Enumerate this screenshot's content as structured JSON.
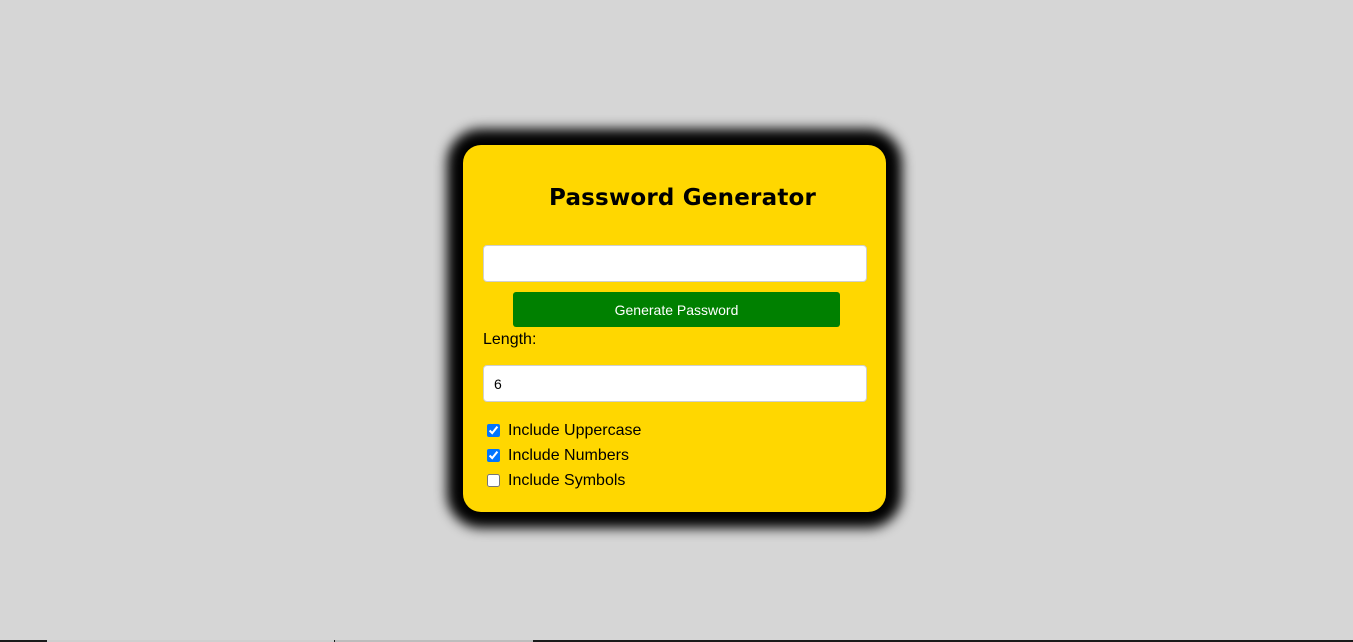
{
  "app": {
    "title": "Password Generator"
  },
  "password": {
    "value": "",
    "placeholder": ""
  },
  "generate_button": {
    "label": "Generate Password"
  },
  "length": {
    "label": "Length:",
    "value": "6"
  },
  "options": [
    {
      "label": "Include Uppercase",
      "checked": true
    },
    {
      "label": "Include Numbers",
      "checked": true
    },
    {
      "label": "Include Symbols",
      "checked": false
    }
  ],
  "colors": {
    "page_background": "#d6d6d6",
    "card_background": "#ffd700",
    "card_shadow": "#000000",
    "button_background": "#008000",
    "button_text": "#ffffff",
    "checkbox_accent": "#0075ff"
  }
}
